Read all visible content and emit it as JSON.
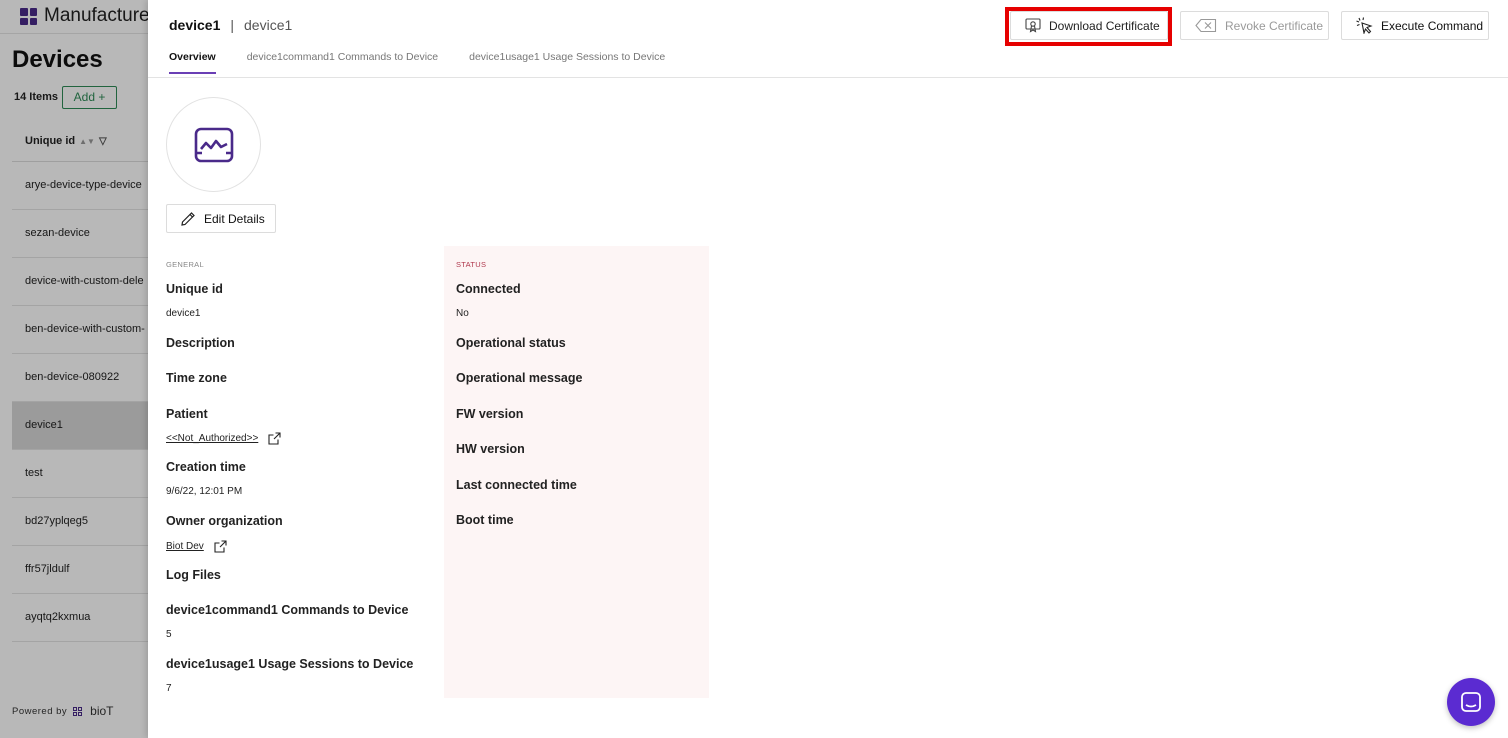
{
  "app": {
    "name": "Manufacturer"
  },
  "list_page": {
    "title": "Devices",
    "count": "14 Items",
    "add_label": "Add +",
    "column_header": "Unique id",
    "rows": [
      "arye-device-type-device",
      "sezan-device",
      "device-with-custom-dele",
      "ben-device-with-custom-",
      "ben-device-080922",
      "device1",
      "test",
      "bd27yplqeg5",
      "ffr57jldulf",
      "ayqtq2kxmua"
    ],
    "selected_row": "device1",
    "powered_by": "Powered by",
    "powered_brand": "bioT"
  },
  "drawer": {
    "breadcrumb": {
      "primary": "device1",
      "separator": "|",
      "secondary": "device1"
    },
    "tabs": [
      "Overview",
      "device1command1 Commands to Device",
      "device1usage1 Usage Sessions to Device"
    ],
    "active_tab": "Overview",
    "actions": {
      "download": "Download Certificate",
      "revoke": "Revoke Certificate",
      "execute": "Execute Command"
    },
    "edit_label": "Edit Details",
    "general": {
      "section": "GENERAL",
      "unique_id_label": "Unique id",
      "unique_id_value": "device1",
      "description_label": "Description",
      "time_zone_label": "Time zone",
      "patient_label": "Patient",
      "patient_value": "<<Not_Authorized>>",
      "creation_time_label": "Creation time",
      "creation_time_value": "9/6/22, 12:01 PM",
      "owner_org_label": "Owner organization",
      "owner_org_value": "Biot Dev",
      "log_files_label": "Log Files",
      "commands_label": "device1command1 Commands to Device",
      "commands_value": "5",
      "usage_label": "device1usage1 Usage Sessions to Device",
      "usage_value": "7"
    },
    "status": {
      "section": "STATUS",
      "connected_label": "Connected",
      "connected_value": "No",
      "operational_status_label": "Operational status",
      "operational_message_label": "Operational message",
      "fw_version_label": "FW version",
      "hw_version_label": "HW version",
      "last_connected_label": "Last connected time",
      "boot_time_label": "Boot time"
    }
  },
  "colors": {
    "brand": "#4a2a8a",
    "accent": "#6a3fb5",
    "chat": "#5b2bd1",
    "highlight": "#e60000",
    "status_label": "#b0384d",
    "add_green": "#2e8b57"
  }
}
